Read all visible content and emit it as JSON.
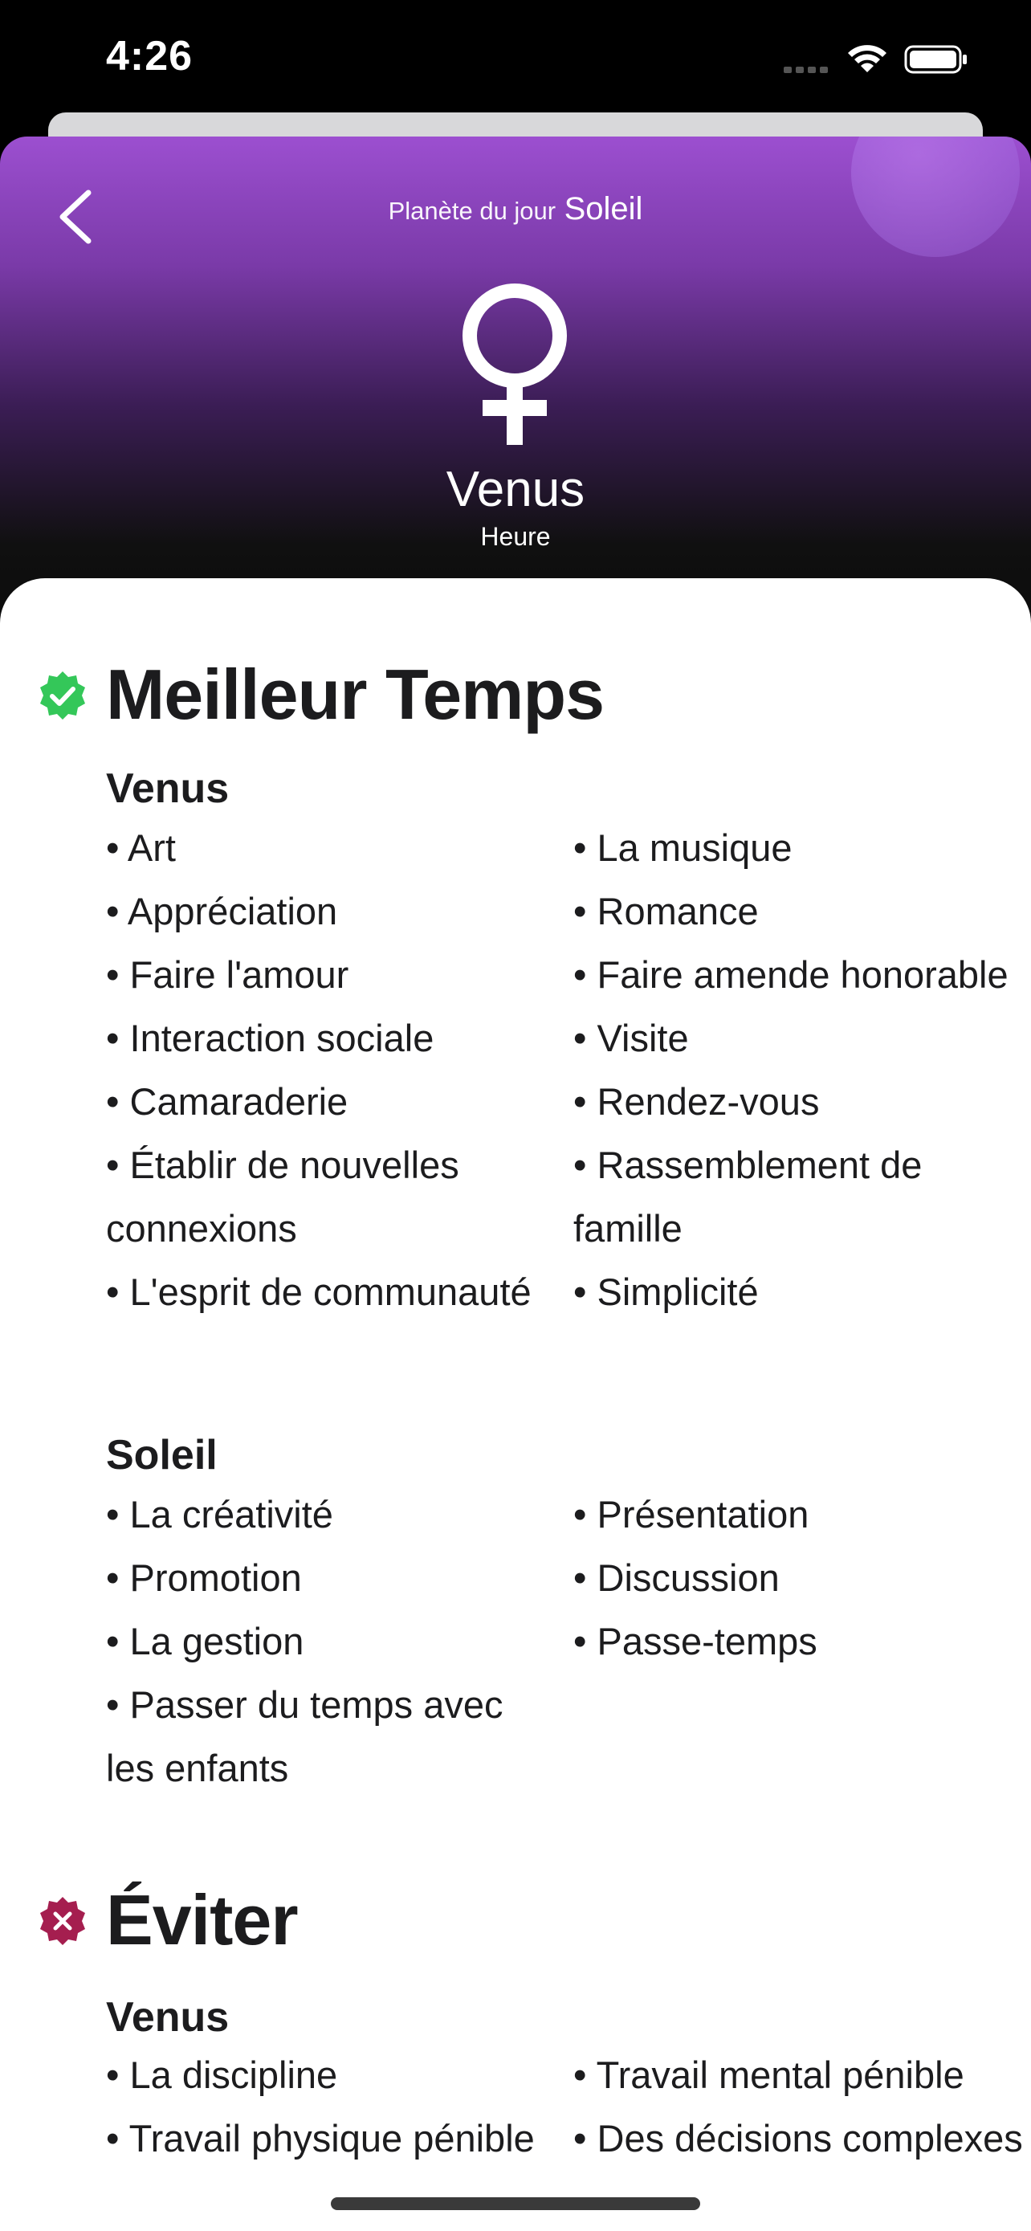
{
  "status_bar": {
    "time": "4:26"
  },
  "header": {
    "subtitle_label": "Planète du jour",
    "subtitle_day": "Soleil",
    "planet": "Venus",
    "planet_sub": "Heure",
    "accent_top": "#9c4fd0",
    "icons": {
      "back": "chevron-left-icon",
      "planet": "venus-symbol-icon"
    }
  },
  "best": {
    "title": "Meilleur Temps",
    "icon": "check-badge-icon",
    "icon_color": "#34c759",
    "groups": [
      {
        "title": "Venus",
        "left": [
          "• Art",
          "• Appréciation",
          "• Faire l'amour",
          "• Interaction sociale",
          "• Camaraderie",
          "• Établir de nouvelles connexions",
          "• L'esprit de communauté"
        ],
        "right": [
          "• La musique",
          "• Romance",
          "• Faire amende honorable",
          "• Visite",
          "• Rendez-vous",
          "• Rassemblement de famille",
          "• Simplicité"
        ]
      },
      {
        "title": "Soleil",
        "left": [
          "• La créativité",
          "• Promotion",
          "• La gestion",
          "• Passer du temps avec les enfants"
        ],
        "right": [
          "• Présentation",
          "• Discussion",
          "• Passe-temps"
        ]
      }
    ]
  },
  "avoid": {
    "title": "Éviter",
    "icon": "x-badge-icon",
    "icon_color": "#a51e4f",
    "groups": [
      {
        "title": "Venus",
        "left": [
          "• La discipline",
          "• Travail physique pénible"
        ],
        "right": [
          "• Travail mental pénible",
          "• Des décisions complexes"
        ]
      }
    ]
  }
}
